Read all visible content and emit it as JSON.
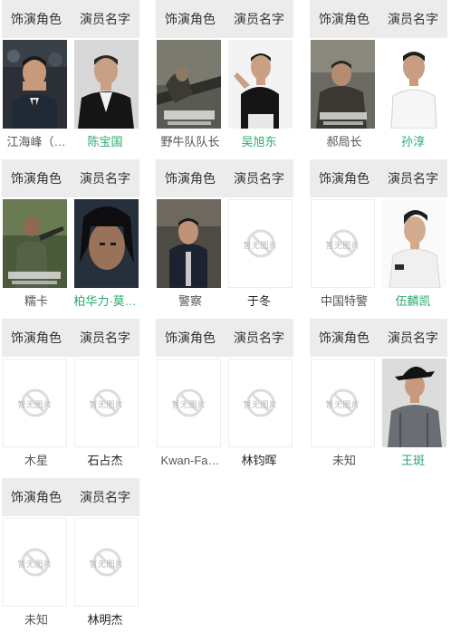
{
  "header": {
    "role_label": "饰演角色",
    "actor_label": "演员名字"
  },
  "placeholder_text": "暂无图片",
  "colors": {
    "header_bg": "#ececec",
    "link_green": "#2aaa6e",
    "role_text": "#555555",
    "actor_text": "#222222"
  },
  "cards": [
    {
      "role": "江海峰（…",
      "actor": "陈宝国",
      "actor_linked": true,
      "role_has_photo": true,
      "actor_has_photo": true
    },
    {
      "role": "野牛队队长",
      "actor": "吴旭东",
      "actor_linked": true,
      "role_has_photo": true,
      "actor_has_photo": true
    },
    {
      "role": "郝局长",
      "actor": "孙淳",
      "actor_linked": true,
      "role_has_photo": true,
      "actor_has_photo": true
    },
    {
      "role": "糯卡",
      "actor": "柏华力·莫…",
      "actor_linked": true,
      "role_has_photo": true,
      "actor_has_photo": true
    },
    {
      "role": "警察",
      "actor": "于冬",
      "actor_linked": false,
      "role_has_photo": true,
      "actor_has_photo": false
    },
    {
      "role": "中国特警",
      "actor": "伍麟凯",
      "actor_linked": true,
      "role_has_photo": false,
      "actor_has_photo": true
    },
    {
      "role": "木星",
      "actor": "石占杰",
      "actor_linked": false,
      "role_has_photo": false,
      "actor_has_photo": false
    },
    {
      "role": "Kwan-Fa…",
      "actor": "林钧晖",
      "actor_linked": false,
      "role_has_photo": false,
      "actor_has_photo": false
    },
    {
      "role": "未知",
      "actor": "王斑",
      "actor_linked": true,
      "role_has_photo": false,
      "actor_has_photo": true
    },
    {
      "role": "未知",
      "actor": "林明杰",
      "actor_linked": false,
      "role_has_photo": false,
      "actor_has_photo": false
    }
  ]
}
